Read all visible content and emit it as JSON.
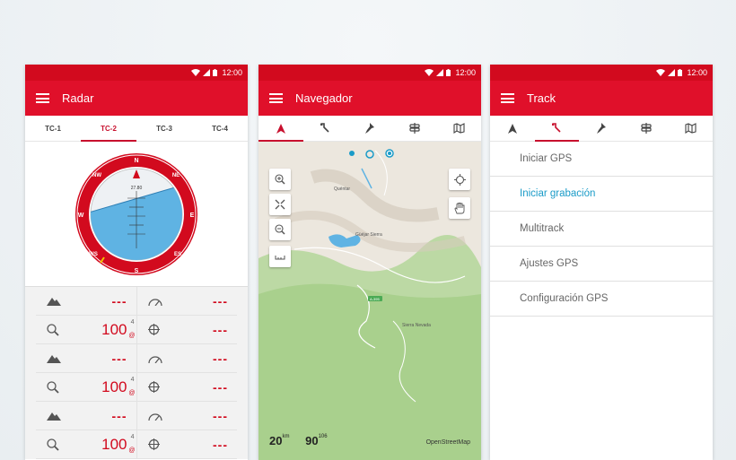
{
  "status": {
    "time": "12:00"
  },
  "radar": {
    "title": "Radar",
    "tabs": [
      "TC-1",
      "TC-2",
      "TC-3",
      "TC-4"
    ],
    "active_tab": 1,
    "compass": {
      "n": "N",
      "s": "S",
      "e": "E",
      "w": "W",
      "ne": "NE",
      "nw": "NW",
      "se": "ES",
      "sw": "WS",
      "value": "27.80"
    },
    "rows": [
      {
        "left": "---",
        "right": "---"
      },
      {
        "left": "100",
        "left_sup": "4",
        "left_sub": "@",
        "right": "---"
      },
      {
        "left": "---",
        "right": "---"
      },
      {
        "left": "100",
        "left_sup": "4",
        "left_sub": "@",
        "right": "---"
      },
      {
        "left": "---",
        "right": "---"
      },
      {
        "left": "100",
        "left_sup": "4",
        "left_sub": "@",
        "right": "---"
      }
    ]
  },
  "navigator": {
    "title": "Navegador",
    "map_labels": [
      "Quéntar",
      "Güéjar Sierra",
      "Sierra Nevada",
      "A-395"
    ],
    "scale_value": "20",
    "scale_unit": "km",
    "zoom_value": "90",
    "zoom_sup": "10",
    "zoom_sub": "6",
    "attribution": "OpenStreetMap"
  },
  "track": {
    "title": "Track",
    "items": [
      "Iniciar GPS",
      "Iniciar grabación",
      "Multitrack",
      "Ajustes GPS",
      "Configuración GPS"
    ],
    "active_item": 1
  },
  "colors": {
    "primary": "#e0102a",
    "statusbar": "#d20a1e",
    "accent_blue": "#1a9bc8",
    "lake": "#5fb3e3"
  }
}
